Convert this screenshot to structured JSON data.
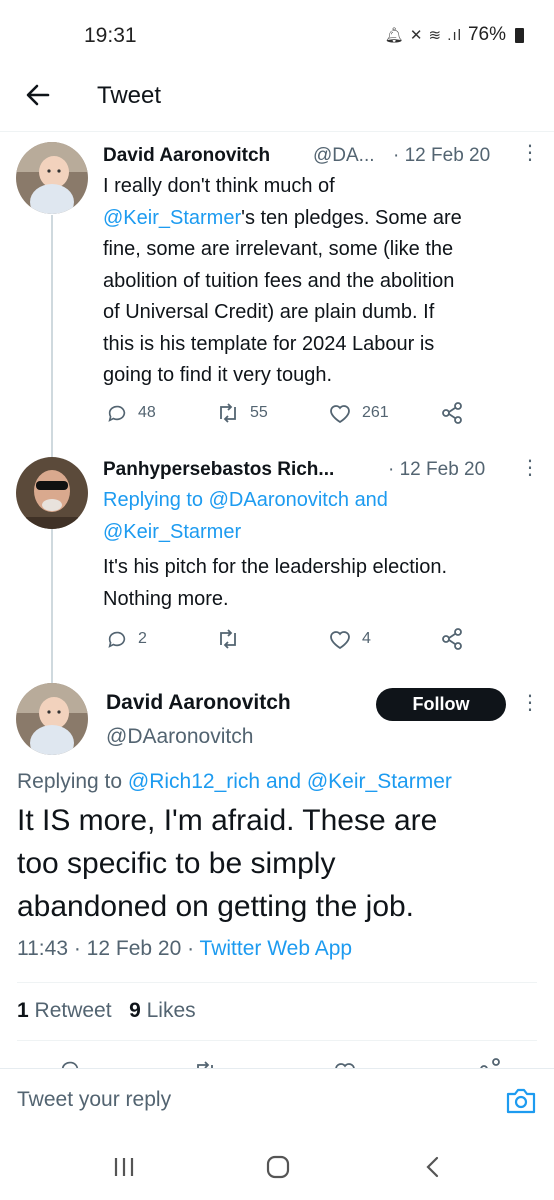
{
  "status": {
    "time": "19:31",
    "battery": "76%"
  },
  "header": {
    "title": "Tweet"
  },
  "tweet1": {
    "name": "David Aaronovitch",
    "handle": "@DA...",
    "date": "· 12 Feb 20",
    "line1": "I really don't think much of",
    "mention": "@Keir_Starmer",
    "line2_rest": "'s ten pledges. Some are",
    "line3": "fine, some are irrelevant, some (like the",
    "line4": "abolition of tuition fees and the abolition",
    "line5": "of Universal Credit) are plain dumb. If",
    "line6": "this is his template for 2024 Labour is",
    "line7": "going to find it very tough.",
    "replies": "48",
    "retweets": "55",
    "likes": "261"
  },
  "tweet2": {
    "name": "Panhypersebastos Rich...",
    "date": "· 12 Feb 20",
    "replying_prefix": "Replying to",
    "replying_user1": "@DAaronovitch",
    "replying_and": "and",
    "replying_user2": "@Keir_Starmer",
    "line1": "It's his pitch for the leadership election.",
    "line2": "Nothing more.",
    "replies": "2",
    "retweets": "",
    "likes": "4"
  },
  "main_tweet": {
    "name": "David Aaronovitch",
    "handle": "@DAaronovitch",
    "follow_label": "Follow",
    "replying_prefix": "Replying to",
    "replying_user1": "@Rich12_rich",
    "replying_and": "and",
    "replying_user2": "@Keir_Starmer",
    "line1": "It IS more, I'm afraid. These are",
    "line2": "too specific to be simply",
    "line3": "abandoned on getting the job.",
    "time": "11:43",
    "date": "· 12 Feb 20 ·",
    "source": "Twitter Web App",
    "retweet_count": "1",
    "retweet_label": "Retweet",
    "like_count": "9",
    "like_label": "Likes"
  },
  "reply": {
    "placeholder": "Tweet your reply"
  }
}
